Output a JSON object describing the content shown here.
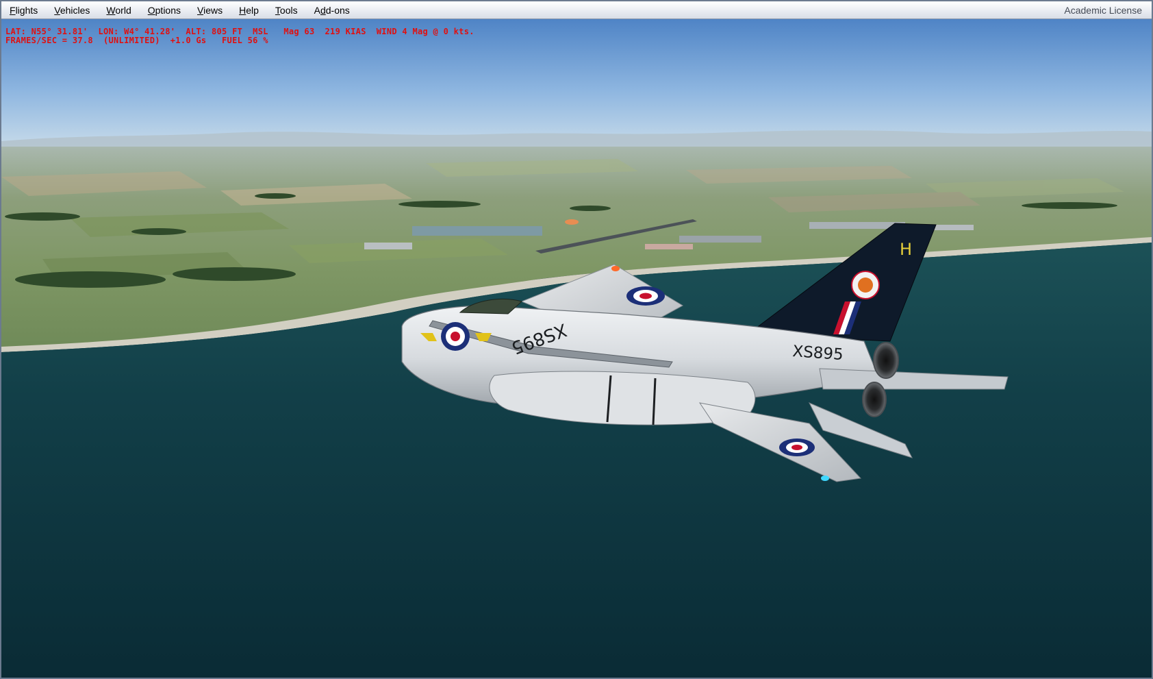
{
  "menu": {
    "items": [
      {
        "mn": "F",
        "rest": "lights"
      },
      {
        "mn": "V",
        "rest": "ehicles"
      },
      {
        "mn": "W",
        "rest": "orld"
      },
      {
        "mn": "O",
        "rest": "ptions"
      },
      {
        "mn": "V",
        "rest": "iews"
      },
      {
        "mn": "H",
        "rest": "elp"
      },
      {
        "mn": "T",
        "rest": "ools"
      },
      {
        "pre": "A",
        "mn": "d",
        "rest": "d-ons"
      }
    ],
    "license": "Academic License"
  },
  "hud": {
    "line1": "LAT: N55° 31.81'  LON: W4° 41.28'  ALT: 805 FT  MSL   Mag 63  219 KIAS  WIND 4 Mag @ 0 kts.",
    "line2": "FRAMES/SEC = 37.8  (UNLIMITED)  +1.0 Gs   FUEL 56 %"
  },
  "aircraft": {
    "serial_tail": "XS895",
    "serial_wing": "XS895",
    "tail_letter": "H"
  },
  "colors": {
    "hud_text": "#e01010",
    "sky_top": "#4f84c6",
    "sea": "#103c46",
    "tail": "#0e1a2a",
    "roundel_blue": "#1c2f78",
    "roundel_red": "#c8102e"
  }
}
